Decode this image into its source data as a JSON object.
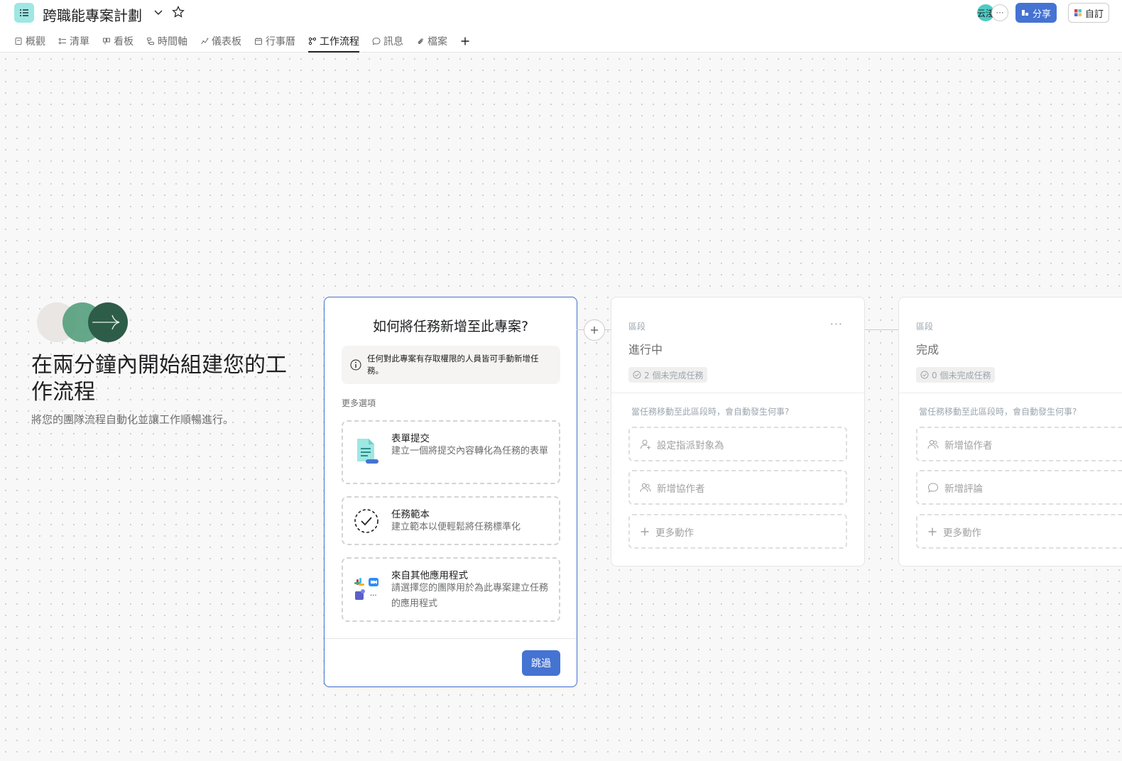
{
  "header": {
    "project_title": "跨職能專案計劃",
    "avatar_text": "云淺",
    "avatar_more": "···",
    "share_label": "分享",
    "customize_label": "自訂"
  },
  "tabs": [
    {
      "label": "概觀",
      "icon": "overview-icon"
    },
    {
      "label": "清單",
      "icon": "list-icon"
    },
    {
      "label": "看板",
      "icon": "board-icon"
    },
    {
      "label": "時間軸",
      "icon": "timeline-icon"
    },
    {
      "label": "儀表板",
      "icon": "dashboard-icon"
    },
    {
      "label": "行事曆",
      "icon": "calendar-icon"
    },
    {
      "label": "工作流程",
      "icon": "workflow-icon",
      "active": true
    },
    {
      "label": "訊息",
      "icon": "message-icon"
    },
    {
      "label": "檔案",
      "icon": "attachment-icon"
    }
  ],
  "intro": {
    "title": "在兩分鐘內開始組建您的工作流程",
    "subtitle": "將您的團隊流程自動化並讓工作順暢進行。"
  },
  "add_panel": {
    "title": "如何將任務新增至此專案?",
    "info": "任何對此專案有存取權限的人員皆可手動新增任務。",
    "more_options_label": "更多選項",
    "options": [
      {
        "title": "表單提交",
        "desc": "建立一個將提交內容轉化為任務的表單",
        "icon": "form-icon"
      },
      {
        "title": "任務範本",
        "desc": "建立範本以便輕鬆將任務標準化",
        "icon": "task-template-icon"
      },
      {
        "title": "來自其他應用程式",
        "desc": "請選擇您的團隊用於為此專案建立任務的應用程式",
        "icon": "apps-icon"
      }
    ],
    "skip_label": "跳過"
  },
  "sections": [
    {
      "label": "區段",
      "name": "進行中",
      "badge": "2 個未完成任務",
      "question": "當任務移動至此區段時，會自動發生何事?",
      "actions": [
        {
          "label": "設定指派對象為",
          "icon": "assignee-icon"
        },
        {
          "label": "新增協作者",
          "icon": "collaborators-icon"
        },
        {
          "label": "更多動作",
          "icon": "plus-icon"
        }
      ]
    },
    {
      "label": "區段",
      "name": "完成",
      "badge": "0 個未完成任務",
      "question": "當任務移動至此區段時，會自動發生何事?",
      "actions": [
        {
          "label": "新增協作者",
          "icon": "collaborators-icon"
        },
        {
          "label": "新增評論",
          "icon": "comment-icon"
        },
        {
          "label": "更多動作",
          "icon": "plus-icon"
        }
      ]
    }
  ],
  "colors": {
    "accent": "#4573d2",
    "project_icon": "#9ee7e3",
    "avatar": "#4ecbc4"
  }
}
